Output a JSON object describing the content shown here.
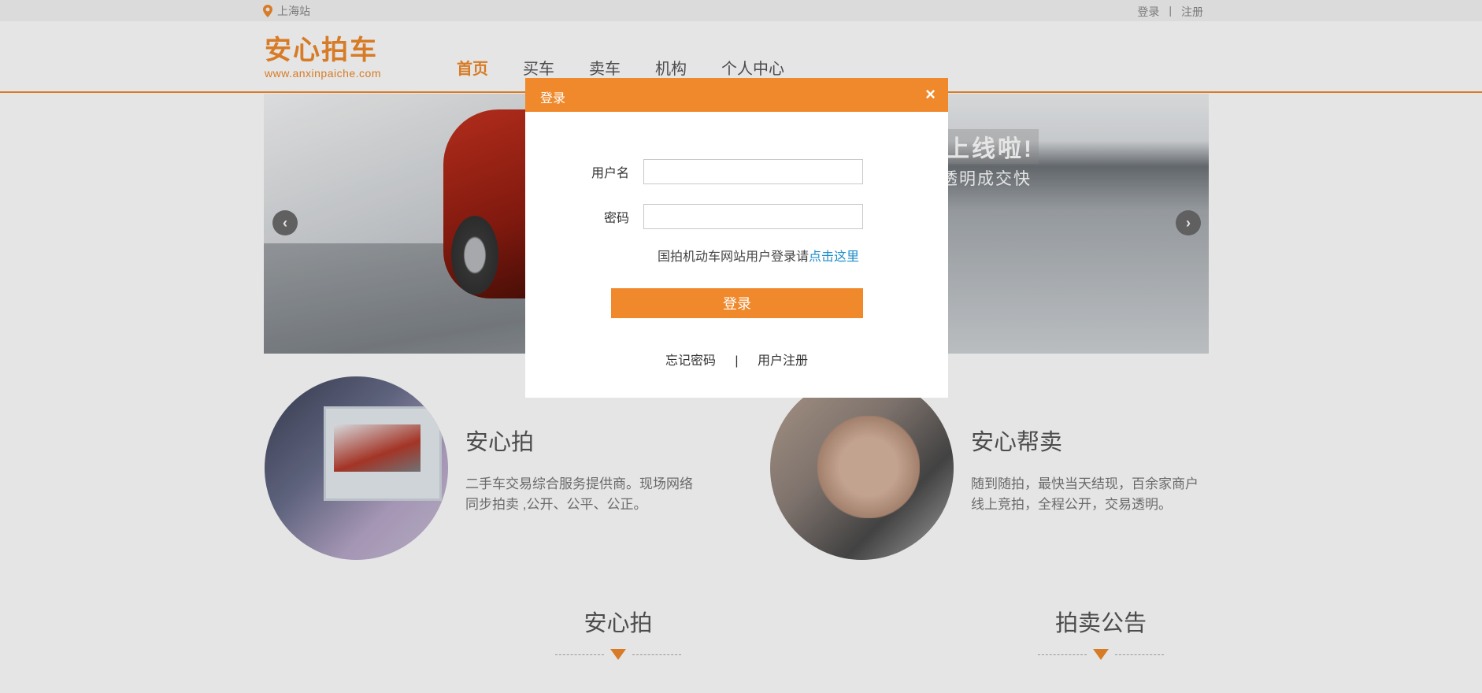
{
  "topbar": {
    "city": "上海站",
    "login": "登录",
    "sep": "|",
    "register": "注册"
  },
  "header": {
    "logo_text": "安心拍车",
    "logo_url": "www.anxinpaiche.com",
    "nav": [
      {
        "label": "首页",
        "active": true
      },
      {
        "label": "买车",
        "active": false
      },
      {
        "label": "卖车",
        "active": false
      },
      {
        "label": "机构",
        "active": false
      },
      {
        "label": "个人中心",
        "active": false
      }
    ]
  },
  "banner": {
    "slogan1": "上线啦!",
    "slogan2": "透明成交快",
    "prev": "‹",
    "next": "›"
  },
  "features": [
    {
      "title": "安心拍",
      "desc": "二手车交易综合服务提供商。现场网络同步拍卖 ,公开、公平、公正。"
    },
    {
      "title": "安心帮卖",
      "desc": "随到随拍，最快当天结现，百余家商户线上竞拍，全程公开，交易透明。"
    }
  ],
  "sections": [
    {
      "title": "安心拍"
    },
    {
      "title": "拍卖公告"
    }
  ],
  "modal": {
    "title": "登录",
    "close": "×",
    "username_label": "用户名",
    "username_value": "",
    "password_label": "密码",
    "password_value": "",
    "hint_text": "国拍机动车网站用户登录请",
    "hint_link": "点击这里",
    "login_button": "登录",
    "forgot": "忘记密码",
    "sep": "|",
    "register": "用户注册"
  },
  "colors": {
    "accent": "#f0892b",
    "link": "#1f8ec9"
  }
}
